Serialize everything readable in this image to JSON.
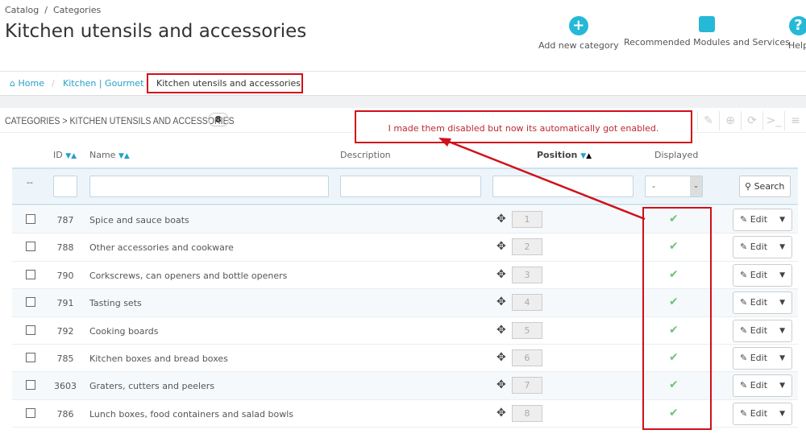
{
  "header": {
    "breadcrumb": [
      "Catalog",
      "Categories"
    ],
    "title": "Kitchen utensils and accessories",
    "toolbar": [
      {
        "label": "Add new category",
        "icon": "plus-circle-icon"
      },
      {
        "label": "Recommended Modules and Services",
        "icon": "puzzle-icon"
      },
      {
        "label": "Help",
        "icon": "question-circle-icon"
      }
    ]
  },
  "breadcrumb": {
    "home": "Home",
    "parent": "Kitchen | Gourmet",
    "current": "Kitchen utensils and accessories"
  },
  "panel": {
    "title": "CATEGORIES > KITCHEN UTENSILS AND ACCESSORIES",
    "count": "8"
  },
  "columns": {
    "id": "ID",
    "name": "Name",
    "description": "Description",
    "position": "Position",
    "displayed": "Displayed"
  },
  "filter": {
    "dash": "--",
    "displayed_select": "-",
    "search": "Search"
  },
  "rows": [
    {
      "id": "787",
      "name": "Spice and sauce boats",
      "position": "1"
    },
    {
      "id": "788",
      "name": "Other accessories and cookware",
      "position": "2"
    },
    {
      "id": "790",
      "name": "Corkscrews, can openers and bottle openers",
      "position": "3"
    },
    {
      "id": "791",
      "name": "Tasting sets",
      "position": "4"
    },
    {
      "id": "792",
      "name": "Cooking boards",
      "position": "5"
    },
    {
      "id": "785",
      "name": "Kitchen boxes and bread boxes",
      "position": "6"
    },
    {
      "id": "3603",
      "name": "Graters, cutters and peelers",
      "position": "7"
    },
    {
      "id": "786",
      "name": "Lunch boxes, food containers and salad bowls",
      "position": "8"
    }
  ],
  "edit_label": "Edit",
  "annotation": {
    "text": "I made them disabled but now its automatically got enabled.",
    "color": "#d0101a"
  }
}
